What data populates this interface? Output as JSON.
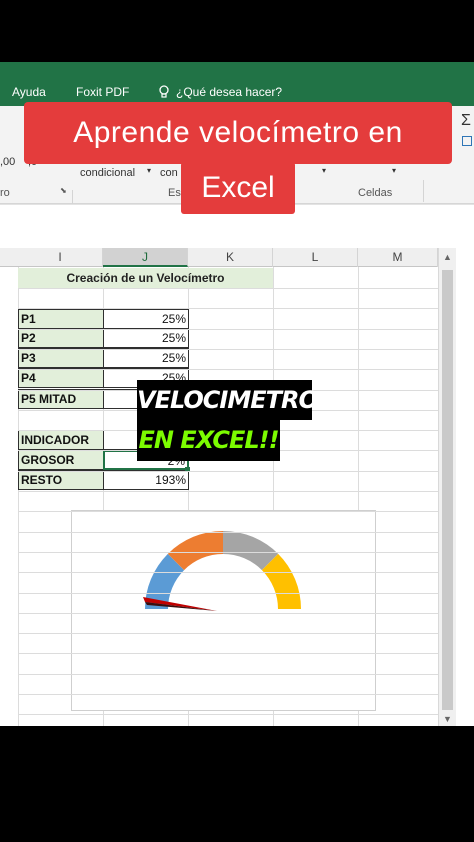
{
  "ribbon": {
    "menu": [
      "Ayuda",
      "Foxit PDF",
      "¿Qué desea hacer?"
    ],
    "row_buttons": [
      "condicional",
      "con"
    ],
    "group_labels": [
      "ro",
      "Es",
      "Celdas"
    ],
    "left_numbers": [
      ",00",
      ",0"
    ]
  },
  "overlay": {
    "title_line1": "Aprende velocímetro en",
    "title_line2": "Excel",
    "caption_line1": "VELOCIMETRO",
    "caption_line2": "EN EXCEL!!"
  },
  "columns": [
    "I",
    "J",
    "K",
    "L",
    "M"
  ],
  "sheet_title": "Creación de un Velocímetro",
  "rows": [
    {
      "label": "P1",
      "value": "25%"
    },
    {
      "label": "P2",
      "value": "25%"
    },
    {
      "label": "P3",
      "value": "25%"
    },
    {
      "label": "P4",
      "value": "25%"
    },
    {
      "label": "P5 MITAD",
      "value": ""
    }
  ],
  "indicators": [
    {
      "label": "INDICADOR",
      "value": ""
    },
    {
      "label": "GROSOR",
      "value": "2%"
    },
    {
      "label": "RESTO",
      "value": "193%"
    }
  ],
  "colors": {
    "excel_green": "#217346",
    "segment_1": "#5b9bd5",
    "segment_2": "#ed7d31",
    "segment_3": "#a5a5a5",
    "segment_4": "#ffc000",
    "needle": "#c00000"
  },
  "gauge": {
    "segments_percent": [
      25,
      25,
      25,
      25
    ],
    "needle_percent": 2
  }
}
